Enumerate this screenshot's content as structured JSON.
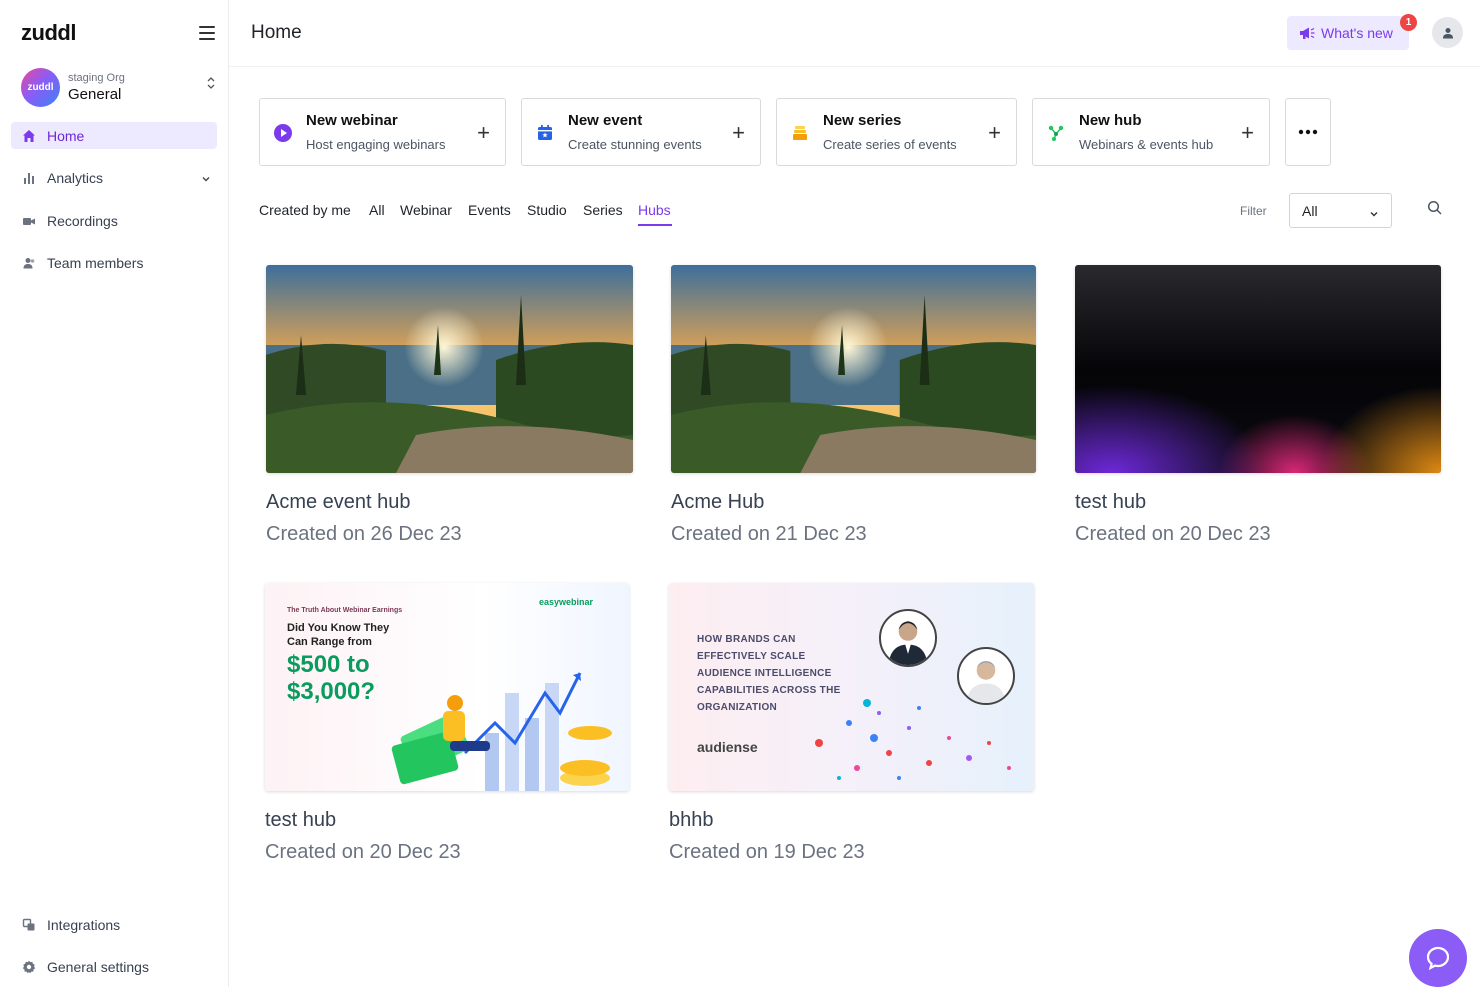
{
  "app": {
    "logo": "zuddl"
  },
  "org": {
    "avatar_text": "zuddl",
    "label_small": "staging Org",
    "label_big": "General",
    "switch_icon": "up-down-chevron-icon"
  },
  "sidebar": {
    "items": [
      {
        "label": "Home",
        "icon": "home-icon",
        "active": true
      },
      {
        "label": "Analytics",
        "icon": "bar-chart-icon",
        "has_dropdown": true
      },
      {
        "label": "Recordings",
        "icon": "video-camera-icon"
      },
      {
        "label": "Team members",
        "icon": "users-icon"
      }
    ],
    "bottom_items": [
      {
        "label": "Integrations",
        "icon": "integrations-icon"
      },
      {
        "label": "General settings",
        "icon": "gear-icon"
      }
    ]
  },
  "header": {
    "title": "Home",
    "whats_new": "What's new",
    "whats_new_badge": "1"
  },
  "create_cards": [
    {
      "title": "New webinar",
      "subtitle": "Host engaging webinars",
      "icon": "play-circle-icon",
      "color": "#7c3aed"
    },
    {
      "title": "New event",
      "subtitle": "Create stunning events",
      "icon": "calendar-icon",
      "color": "#2563eb"
    },
    {
      "title": "New series",
      "subtitle": "Create series of events",
      "icon": "stack-icon",
      "color": "#f59e0b"
    },
    {
      "title": "New hub",
      "subtitle": "Webinars & events hub",
      "icon": "hub-nodes-icon",
      "color": "#22c55e"
    }
  ],
  "tabs": [
    {
      "label": "Created by me"
    },
    {
      "label": "All"
    },
    {
      "label": "Webinar"
    },
    {
      "label": "Events"
    },
    {
      "label": "Studio"
    },
    {
      "label": "Series"
    },
    {
      "label": "Hubs",
      "active": true
    }
  ],
  "filter": {
    "label": "Filter",
    "value": "All"
  },
  "hubs": [
    {
      "name": "Acme event hub",
      "date": "Created on 26 Dec 23",
      "image": "lake-sunset"
    },
    {
      "name": "Acme Hub",
      "date": "Created on 21 Dec 23",
      "image": "lake-sunset"
    },
    {
      "name": "test hub",
      "date": "Created on 20 Dec 23",
      "image": "dark-gradient"
    },
    {
      "name": "test hub",
      "date": "Created on 20 Dec 23",
      "image": "webinar-promo"
    },
    {
      "name": "bhhb",
      "date": "Created on 19 Dec 23",
      "image": "audiense-promo"
    }
  ],
  "promo": {
    "small": "The Truth About Webinar Earnings",
    "question_1": "Did You Know They",
    "question_2": "Can Range from",
    "big_1": "$500 to",
    "big_2": "$3,000?",
    "brand": "easywebinar"
  },
  "audiense": {
    "line_1": "HOW BRANDS CAN",
    "line_2": "EFFECTIVELY SCALE",
    "line_3": "AUDIENCE INTELLIGENCE",
    "line_4": "CAPABILITIES ACROSS THE",
    "line_5": "ORGANIZATION",
    "brand": "audiense"
  },
  "colors": {
    "accent": "#7c3aed",
    "accent_light": "#ede9fe",
    "badge": "#ef4444"
  }
}
